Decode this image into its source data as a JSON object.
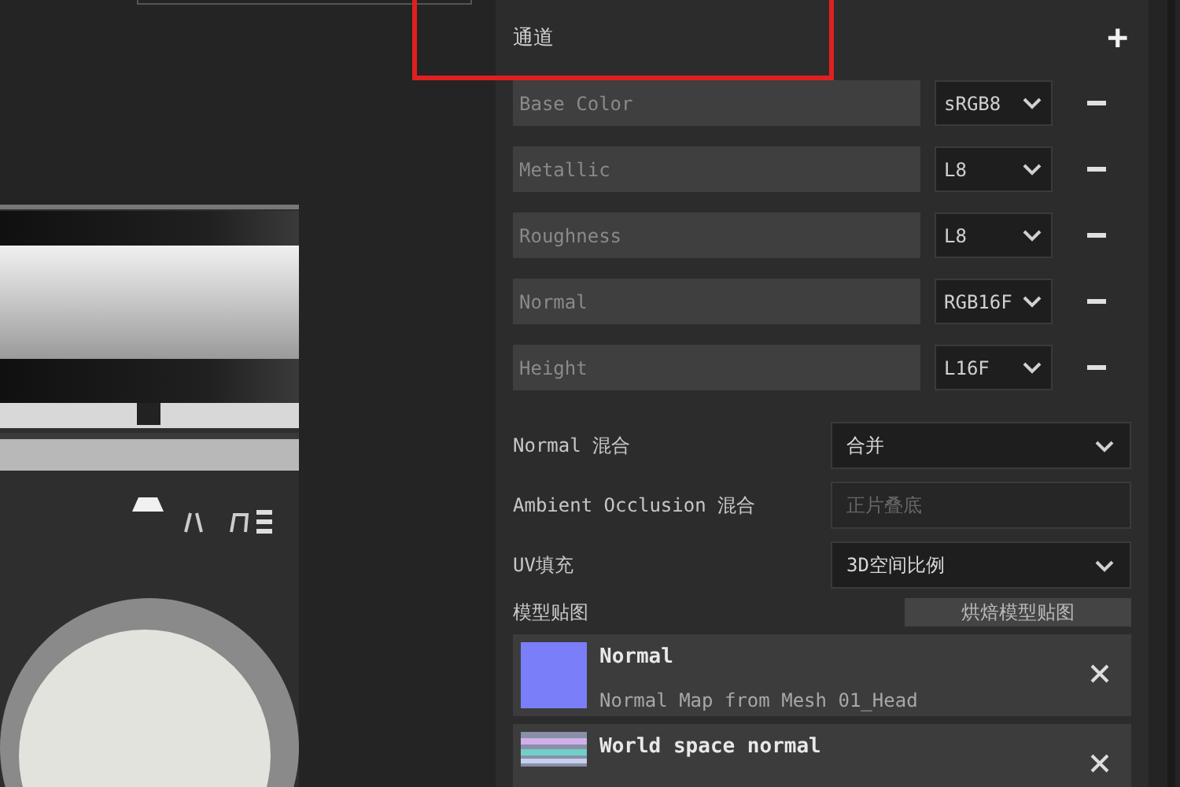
{
  "channels_section": {
    "title": "通道",
    "add_icon": "+"
  },
  "channels": [
    {
      "name": "Base Color",
      "format": "sRGB8"
    },
    {
      "name": "Metallic",
      "format": "L8"
    },
    {
      "name": "Roughness",
      "format": "L8"
    },
    {
      "name": "Normal",
      "format": "RGB16F"
    },
    {
      "name": "Height",
      "format": "L16F"
    }
  ],
  "settings": [
    {
      "label": "Normal 混合",
      "value": "合并",
      "disabled": false
    },
    {
      "label": "Ambient Occlusion 混合",
      "value": "正片叠底",
      "disabled": true
    },
    {
      "label": "UV填充",
      "value": "3D空间比例",
      "disabled": false
    }
  ],
  "mesh_maps": {
    "title": "模型贴图",
    "bake_button": "烘焙模型贴图",
    "items": [
      {
        "kind": "normal",
        "name": "Normal",
        "description": "Normal Map from Mesh 01_Head"
      },
      {
        "kind": "world",
        "name": "World space normal"
      }
    ]
  }
}
